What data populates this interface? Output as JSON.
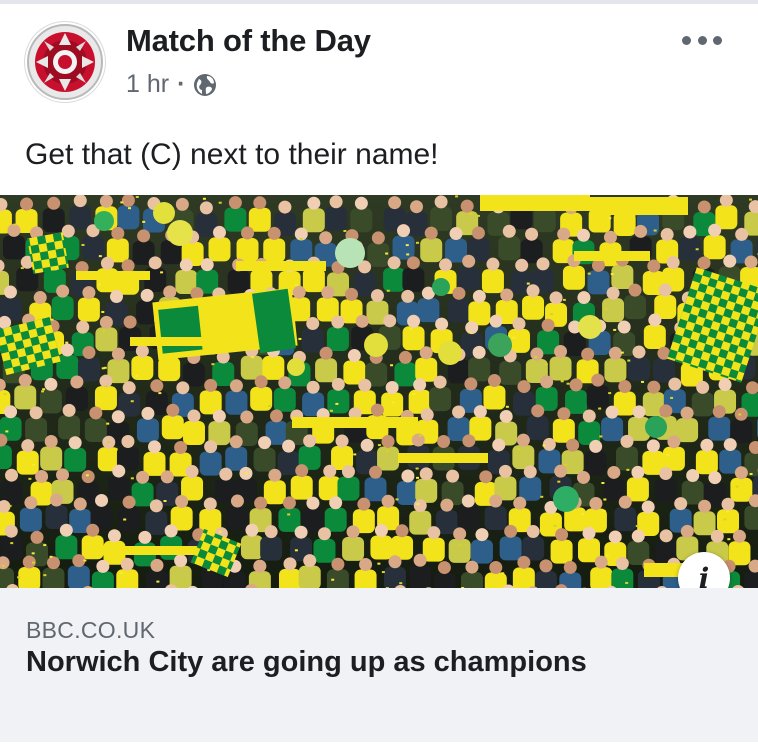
{
  "post": {
    "page_name": "Match of the Day",
    "time": "1 hr",
    "separator": "·",
    "privacy_icon": "globe-icon",
    "more_icon": "more-horizontal-icon",
    "text": "Get that (C) next to their name!"
  },
  "image": {
    "description_icon": "info-icon",
    "info_label": "i"
  },
  "link_preview": {
    "domain": "BBC.CO.UK",
    "headline": "Norwich City are going up as champions"
  },
  "colors": {
    "text_primary": "#1c1e21",
    "text_secondary": "#606770",
    "preview_bg": "#f0f2f5",
    "norwich_yellow": "#f2e31b",
    "norwich_green": "#0c8a3c",
    "motd_red": "#c8102e"
  }
}
